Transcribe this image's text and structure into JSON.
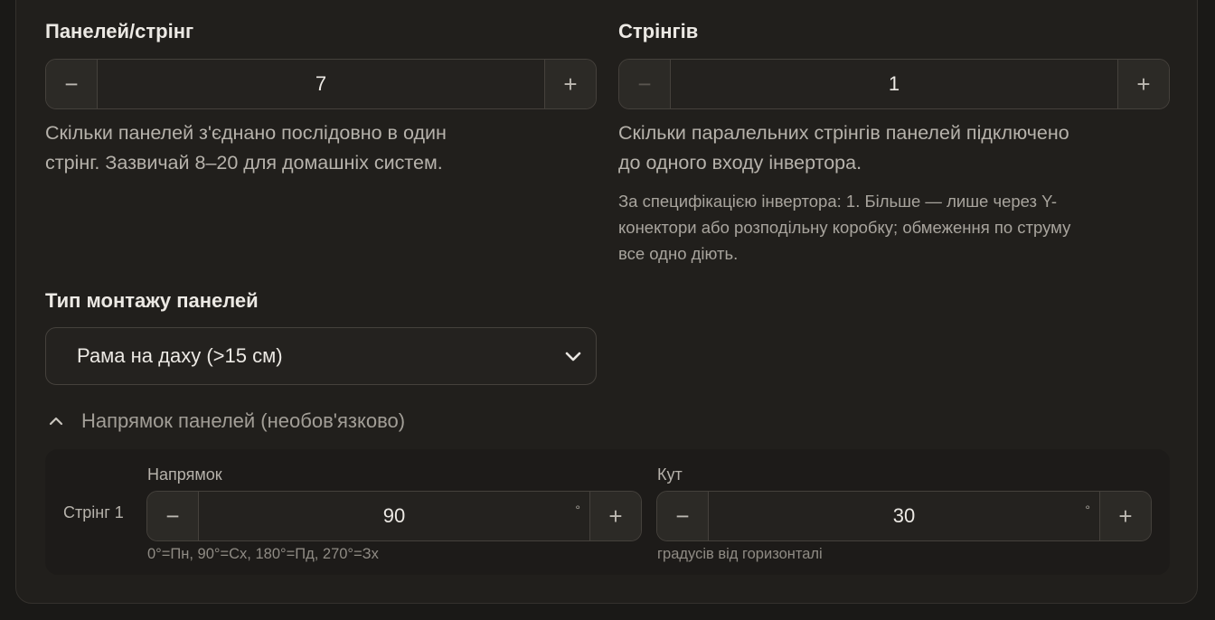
{
  "panels_per_string": {
    "label": "Панелей/стрінг",
    "value": "7",
    "minus": "−",
    "plus": "+",
    "help_line1": "Скільки панелей з'єднано послідовно в один",
    "help_line2": "стрінг. Зазвичай 8–20 для домашніх систем."
  },
  "strings": {
    "label": "Стрінгів",
    "value": "1",
    "minus": "−",
    "plus": "+",
    "help_line1": "Скільки паралельних стрінгів панелей підключено",
    "help_line2": "до одного входу інвертора.",
    "note_line1": "За специфікацією інвертора: 1. Більше — лише через Y-",
    "note_line2": "конектори або розподільну коробку; обмеження по струму",
    "note_line3": "все одно діють."
  },
  "mounting": {
    "label": "Тип монтажу панелей",
    "selected": "Рама на даху (>15 см)"
  },
  "orientation_section": {
    "title": "Напрямок панелей (необов'язково)",
    "expanded": true,
    "rows": [
      {
        "string_label": "Стрінг 1",
        "direction": {
          "label": "Напрямок",
          "value": "90",
          "unit": "°",
          "minus": "−",
          "plus": "+",
          "hint": "0°=Пн, 90°=Сх, 180°=Пд, 270°=Зх"
        },
        "angle": {
          "label": "Кут",
          "value": "30",
          "unit": "°",
          "minus": "−",
          "plus": "+",
          "hint": "градусів від горизонталі"
        }
      }
    ]
  },
  "colors": {
    "background": "#1a1917",
    "card": "#211f1c",
    "border": "#45413c",
    "text": "#ece9e4",
    "muted": "#b6b2ab"
  }
}
